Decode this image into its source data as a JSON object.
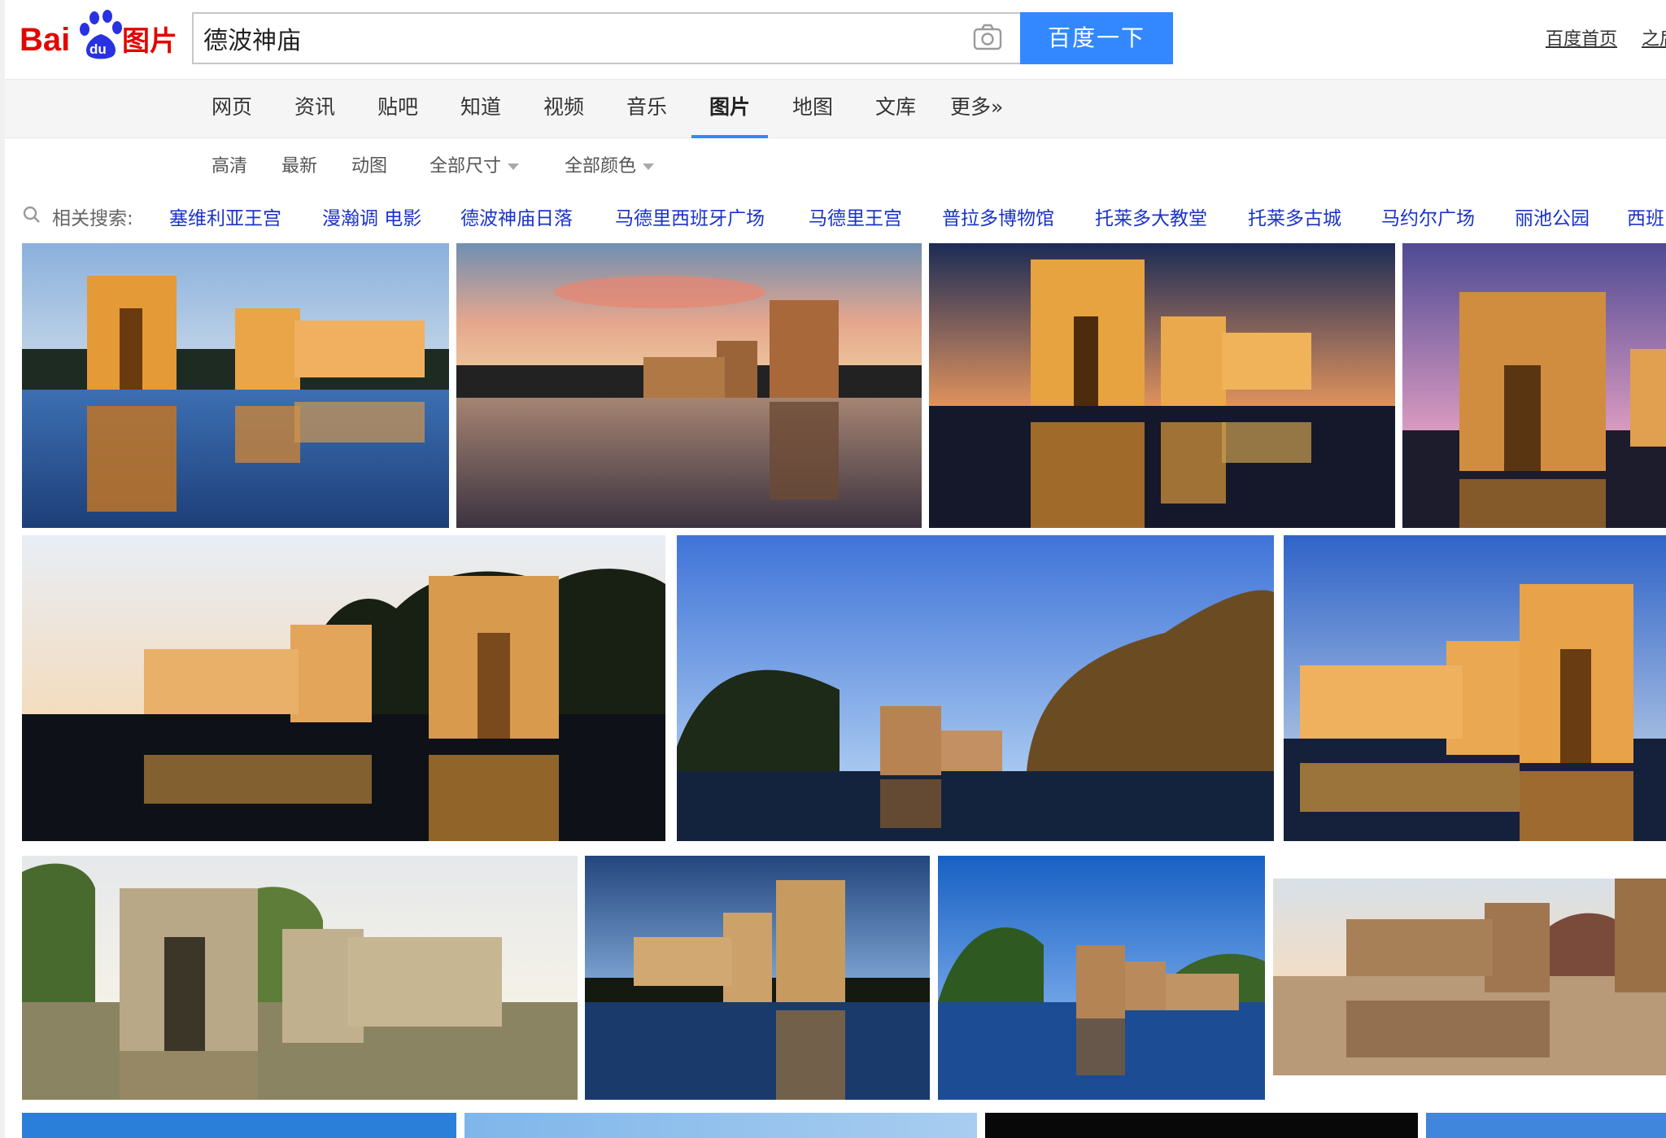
{
  "header": {
    "logo_text": "Bai du 图片",
    "search_value": "德波神庙",
    "search_button": "百度一下",
    "links": [
      "百度首页",
      "之后"
    ]
  },
  "nav": {
    "tabs": [
      {
        "label": "网页"
      },
      {
        "label": "资讯"
      },
      {
        "label": "贴吧"
      },
      {
        "label": "知道"
      },
      {
        "label": "视频"
      },
      {
        "label": "音乐"
      },
      {
        "label": "图片",
        "active": true
      },
      {
        "label": "地图"
      },
      {
        "label": "文库"
      },
      {
        "label": "更多»"
      }
    ]
  },
  "filters": {
    "items": [
      "高清",
      "最新",
      "动图"
    ],
    "size_dropdown": "全部尺寸",
    "color_dropdown": "全部颜色"
  },
  "related": {
    "label": "相关搜索:",
    "items": [
      "塞维利亚王宫",
      "漫瀚调 电影",
      "德波神庙日落",
      "马德里西班牙广场",
      "马德里王宫",
      "普拉多博物馆",
      "托莱多大教堂",
      "托莱多古城",
      "马约尔广场",
      "丽池公园",
      "西班"
    ]
  },
  "colors": {
    "accent": "#3388ff",
    "link": "#1b33c8",
    "logo_red": "#e10601",
    "logo_blue": "#2932e1"
  },
  "icons": [
    "camera-icon",
    "search-icon",
    "baidu-paw-icon"
  ]
}
